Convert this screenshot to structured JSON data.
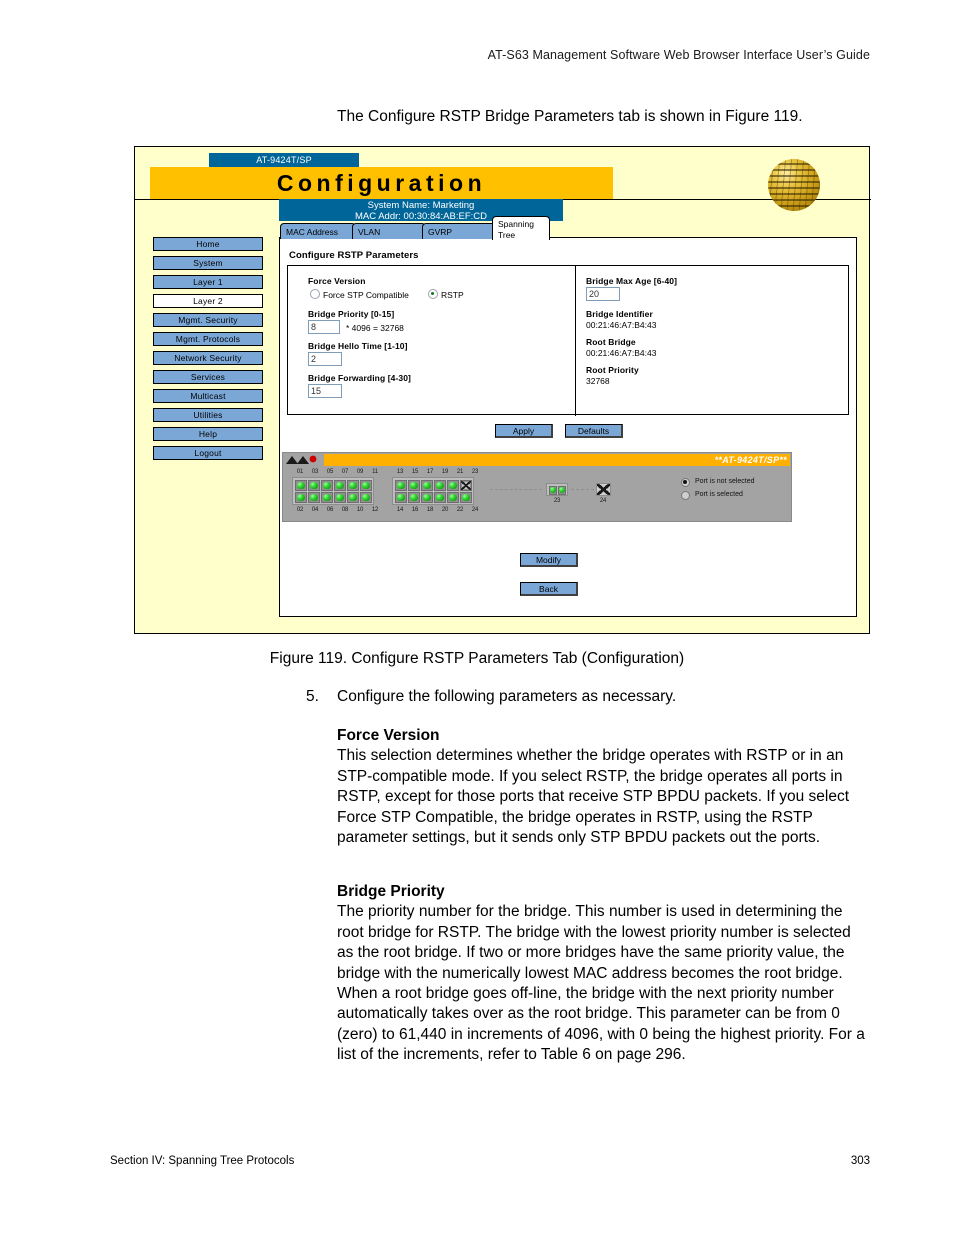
{
  "document": {
    "running_header": "AT-S63 Management Software Web Browser Interface User’s Guide",
    "intro_line": "The Configure RSTP Bridge Parameters tab is shown in Figure 119.",
    "figure_caption": "Figure 119. Configure RSTP Parameters Tab (Configuration)",
    "step_number": "5.",
    "step_text": "Configure the following parameters as necessary.",
    "sections": [
      {
        "heading": "Force Version",
        "body": "This selection determines whether the bridge operates with RSTP or in an STP-compatible mode. If you select RSTP, the bridge operates all ports in RSTP, except for those ports that receive STP BPDU packets. If you select Force STP Compatible, the bridge operates in RSTP, using the RSTP parameter settings, but it sends only STP BPDU packets out the ports."
      },
      {
        "heading": "Bridge Priority",
        "body": "The priority number for the bridge. This number is used in determining the root bridge for RSTP. The bridge with the lowest priority number is selected as the root bridge. If two or more bridges have the same priority value, the bridge with the numerically lowest MAC address becomes the root bridge. When a root bridge goes off-line, the bridge with the next priority number automatically takes over as the root bridge. This parameter can be from 0 (zero) to 61,440 in increments of 4096, with 0 being the highest priority. For a list of the increments, refer to Table 6 on page 296."
      }
    ],
    "footer_left": "Section IV: Spanning Tree Protocols",
    "footer_right": "303"
  },
  "screenshot": {
    "device_tab": "AT-9424T/SP",
    "title_bar": "Configuration",
    "system_name_line": "System Name: Marketing",
    "mac_addr_line": "MAC Addr: 00:30:84:AB:EF:CD",
    "globe_icon": "globe-icon",
    "sidebar": {
      "items": [
        {
          "label": "Home",
          "active": false
        },
        {
          "label": "System",
          "active": false
        },
        {
          "label": "Layer 1",
          "active": false
        },
        {
          "label": "Layer 2",
          "active": true
        },
        {
          "label": "Mgmt. Security",
          "active": false
        },
        {
          "label": "Mgmt. Protocols",
          "active": false
        },
        {
          "label": "Network Security",
          "active": false
        },
        {
          "label": "Services",
          "active": false
        },
        {
          "label": "Multicast",
          "active": false
        },
        {
          "label": "Utilities",
          "active": false
        },
        {
          "label": "Help",
          "active": false
        },
        {
          "label": "Logout",
          "active": false
        }
      ]
    },
    "tabs": [
      {
        "label": "MAC Address",
        "active": false
      },
      {
        "label": "VLAN",
        "active": false
      },
      {
        "label": "GVRP",
        "active": false
      },
      {
        "label": "Spanning Tree",
        "active": true
      }
    ],
    "panel": {
      "title": "Configure RSTP Parameters",
      "force_version": {
        "label": "Force Version",
        "options": [
          {
            "label": "Force STP Compatible",
            "selected": false
          },
          {
            "label": "RSTP",
            "selected": true
          }
        ]
      },
      "bridge_priority": {
        "label": "Bridge Priority [0-15]",
        "value": "8",
        "suffix": "* 4096 = 32768"
      },
      "bridge_hello_time": {
        "label": "Bridge Hello Time [1-10]",
        "value": "2"
      },
      "bridge_forwarding": {
        "label": "Bridge Forwarding [4-30]",
        "value": "15"
      },
      "bridge_max_age": {
        "label": "Bridge Max Age [6-40]",
        "value": "20"
      },
      "bridge_identifier": {
        "label": "Bridge Identifier",
        "value": "00:21:46:A7:B4:43"
      },
      "root_bridge": {
        "label": "Root Bridge",
        "value": "00:21:46:A7:B4:43"
      },
      "root_priority": {
        "label": "Root Priority",
        "value": "32768"
      },
      "buttons": {
        "apply": "Apply",
        "defaults": "Defaults",
        "modify": "Modify",
        "back": "Back"
      }
    },
    "switch_panel": {
      "model_label": "**AT-9424T/SP**",
      "top_row_labels": [
        "01",
        "03",
        "05",
        "07",
        "09",
        "11",
        "13",
        "15",
        "17",
        "19",
        "21",
        "23"
      ],
      "bottom_row_labels": [
        "02",
        "04",
        "06",
        "08",
        "10",
        "12",
        "14",
        "16",
        "18",
        "20",
        "22",
        "24"
      ],
      "uplink_a_label": "23",
      "uplink_b_label": "24",
      "legend": [
        {
          "label": "Port is not selected",
          "selected": true
        },
        {
          "label": "Port is selected",
          "selected": false
        }
      ]
    }
  },
  "colors": {
    "page_bg": "#ffffcc",
    "title_bar": "#ffc000",
    "info_bar": "#006699",
    "button_blue": "#7ba7d7",
    "panel_gray": "#a3a3a3",
    "led_green": "#2fd62f",
    "orange_strip": "#ffb000"
  }
}
